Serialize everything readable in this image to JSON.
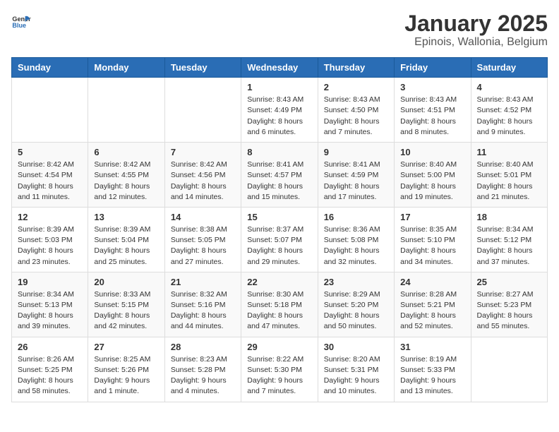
{
  "header": {
    "logo_general": "General",
    "logo_blue": "Blue",
    "title": "January 2025",
    "subtitle": "Epinois, Wallonia, Belgium"
  },
  "days_of_week": [
    "Sunday",
    "Monday",
    "Tuesday",
    "Wednesday",
    "Thursday",
    "Friday",
    "Saturday"
  ],
  "weeks": [
    [
      {
        "day": "",
        "info": ""
      },
      {
        "day": "",
        "info": ""
      },
      {
        "day": "",
        "info": ""
      },
      {
        "day": "1",
        "info": "Sunrise: 8:43 AM\nSunset: 4:49 PM\nDaylight: 8 hours\nand 6 minutes."
      },
      {
        "day": "2",
        "info": "Sunrise: 8:43 AM\nSunset: 4:50 PM\nDaylight: 8 hours\nand 7 minutes."
      },
      {
        "day": "3",
        "info": "Sunrise: 8:43 AM\nSunset: 4:51 PM\nDaylight: 8 hours\nand 8 minutes."
      },
      {
        "day": "4",
        "info": "Sunrise: 8:43 AM\nSunset: 4:52 PM\nDaylight: 8 hours\nand 9 minutes."
      }
    ],
    [
      {
        "day": "5",
        "info": "Sunrise: 8:42 AM\nSunset: 4:54 PM\nDaylight: 8 hours\nand 11 minutes."
      },
      {
        "day": "6",
        "info": "Sunrise: 8:42 AM\nSunset: 4:55 PM\nDaylight: 8 hours\nand 12 minutes."
      },
      {
        "day": "7",
        "info": "Sunrise: 8:42 AM\nSunset: 4:56 PM\nDaylight: 8 hours\nand 14 minutes."
      },
      {
        "day": "8",
        "info": "Sunrise: 8:41 AM\nSunset: 4:57 PM\nDaylight: 8 hours\nand 15 minutes."
      },
      {
        "day": "9",
        "info": "Sunrise: 8:41 AM\nSunset: 4:59 PM\nDaylight: 8 hours\nand 17 minutes."
      },
      {
        "day": "10",
        "info": "Sunrise: 8:40 AM\nSunset: 5:00 PM\nDaylight: 8 hours\nand 19 minutes."
      },
      {
        "day": "11",
        "info": "Sunrise: 8:40 AM\nSunset: 5:01 PM\nDaylight: 8 hours\nand 21 minutes."
      }
    ],
    [
      {
        "day": "12",
        "info": "Sunrise: 8:39 AM\nSunset: 5:03 PM\nDaylight: 8 hours\nand 23 minutes."
      },
      {
        "day": "13",
        "info": "Sunrise: 8:39 AM\nSunset: 5:04 PM\nDaylight: 8 hours\nand 25 minutes."
      },
      {
        "day": "14",
        "info": "Sunrise: 8:38 AM\nSunset: 5:05 PM\nDaylight: 8 hours\nand 27 minutes."
      },
      {
        "day": "15",
        "info": "Sunrise: 8:37 AM\nSunset: 5:07 PM\nDaylight: 8 hours\nand 29 minutes."
      },
      {
        "day": "16",
        "info": "Sunrise: 8:36 AM\nSunset: 5:08 PM\nDaylight: 8 hours\nand 32 minutes."
      },
      {
        "day": "17",
        "info": "Sunrise: 8:35 AM\nSunset: 5:10 PM\nDaylight: 8 hours\nand 34 minutes."
      },
      {
        "day": "18",
        "info": "Sunrise: 8:34 AM\nSunset: 5:12 PM\nDaylight: 8 hours\nand 37 minutes."
      }
    ],
    [
      {
        "day": "19",
        "info": "Sunrise: 8:34 AM\nSunset: 5:13 PM\nDaylight: 8 hours\nand 39 minutes."
      },
      {
        "day": "20",
        "info": "Sunrise: 8:33 AM\nSunset: 5:15 PM\nDaylight: 8 hours\nand 42 minutes."
      },
      {
        "day": "21",
        "info": "Sunrise: 8:32 AM\nSunset: 5:16 PM\nDaylight: 8 hours\nand 44 minutes."
      },
      {
        "day": "22",
        "info": "Sunrise: 8:30 AM\nSunset: 5:18 PM\nDaylight: 8 hours\nand 47 minutes."
      },
      {
        "day": "23",
        "info": "Sunrise: 8:29 AM\nSunset: 5:20 PM\nDaylight: 8 hours\nand 50 minutes."
      },
      {
        "day": "24",
        "info": "Sunrise: 8:28 AM\nSunset: 5:21 PM\nDaylight: 8 hours\nand 52 minutes."
      },
      {
        "day": "25",
        "info": "Sunrise: 8:27 AM\nSunset: 5:23 PM\nDaylight: 8 hours\nand 55 minutes."
      }
    ],
    [
      {
        "day": "26",
        "info": "Sunrise: 8:26 AM\nSunset: 5:25 PM\nDaylight: 8 hours\nand 58 minutes."
      },
      {
        "day": "27",
        "info": "Sunrise: 8:25 AM\nSunset: 5:26 PM\nDaylight: 9 hours\nand 1 minute."
      },
      {
        "day": "28",
        "info": "Sunrise: 8:23 AM\nSunset: 5:28 PM\nDaylight: 9 hours\nand 4 minutes."
      },
      {
        "day": "29",
        "info": "Sunrise: 8:22 AM\nSunset: 5:30 PM\nDaylight: 9 hours\nand 7 minutes."
      },
      {
        "day": "30",
        "info": "Sunrise: 8:20 AM\nSunset: 5:31 PM\nDaylight: 9 hours\nand 10 minutes."
      },
      {
        "day": "31",
        "info": "Sunrise: 8:19 AM\nSunset: 5:33 PM\nDaylight: 9 hours\nand 13 minutes."
      },
      {
        "day": "",
        "info": ""
      }
    ]
  ]
}
